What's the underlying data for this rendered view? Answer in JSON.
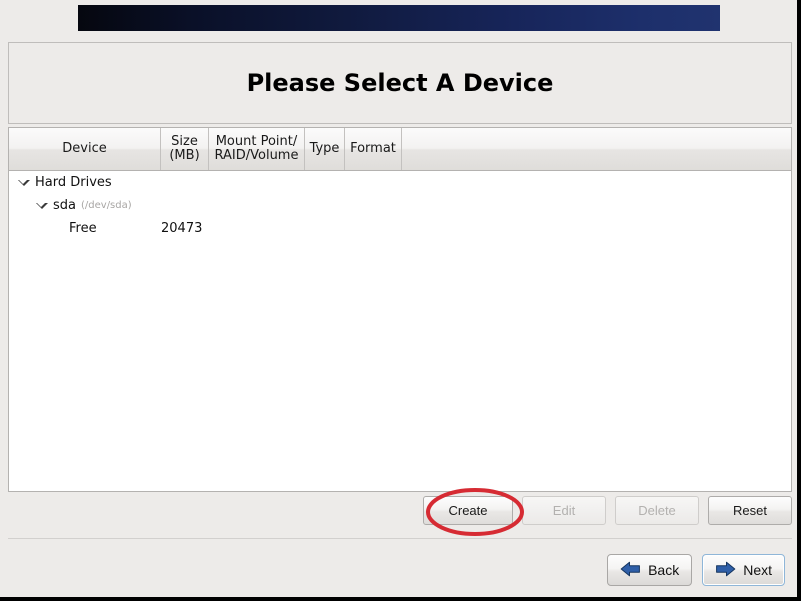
{
  "window": {
    "title": "Please Select A Device"
  },
  "banner": {
    "gradient_start": "#05070f",
    "gradient_end": "#20336f"
  },
  "device_table": {
    "columns": [
      {
        "label": "Device"
      },
      {
        "label": "Size\n(MB)",
        "line1": "Size",
        "line2": "(MB)"
      },
      {
        "label": "Mount Point/\nRAID/Volume",
        "line1": "Mount Point/",
        "line2": "RAID/Volume"
      },
      {
        "label": "Type"
      },
      {
        "label": "Format"
      }
    ],
    "rows": [
      {
        "device": "Hard Drives",
        "device_sub": "",
        "size": "",
        "mount": "",
        "type": "",
        "format": "",
        "indent": 0,
        "expander": "triangle-down-icon"
      },
      {
        "device": "sda",
        "device_sub": "(/dev/sda)",
        "size": "",
        "mount": "",
        "type": "",
        "format": "",
        "indent": 1,
        "expander": "triangle-down-icon"
      },
      {
        "device": "Free",
        "device_sub": "",
        "size": "20473",
        "mount": "",
        "type": "",
        "format": "",
        "indent": 2,
        "expander": ""
      }
    ]
  },
  "action_buttons": {
    "create": "Create",
    "edit": "Edit",
    "delete": "Delete",
    "reset": "Reset"
  },
  "navigation": {
    "back": "Back",
    "next": "Next",
    "back_icon": "arrow-left-icon",
    "next_icon": "arrow-right-icon",
    "arrow_color": "#2f5fa8"
  },
  "annotation": {
    "shape": "ellipse",
    "color": "#d62b33",
    "target": "Create"
  }
}
